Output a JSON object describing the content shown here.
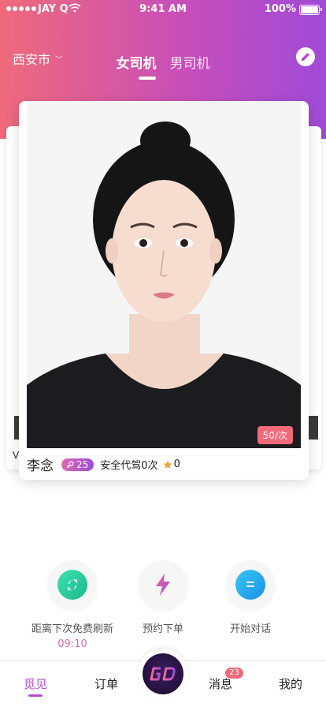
{
  "status_bar": {
    "carrier": "JAY Q",
    "time": "9:41 AM",
    "battery": "100%"
  },
  "header": {
    "city": "西安市",
    "tabs": [
      {
        "label": "女司机"
      },
      {
        "label": "男司机"
      }
    ]
  },
  "side_letter": "V",
  "card": {
    "price": "50/次",
    "name": "李念",
    "age": "25",
    "safe_text": "安全代驾0次",
    "rating": "0"
  },
  "actions": [
    {
      "label": "距离下次免费刷新",
      "sub": "09:10",
      "icon": "refresh-icon"
    },
    {
      "label": "预约下单",
      "icon": "lightning-icon"
    },
    {
      "label": "开始对话",
      "icon": "chat-icon"
    }
  ],
  "bottom_nav": {
    "items": [
      {
        "label": "觅见"
      },
      {
        "label": "订单"
      },
      {
        "label": "消息"
      },
      {
        "label": "我的"
      }
    ],
    "msg_badge": "23",
    "center_icon": "gd-logo-icon"
  },
  "colors": {
    "accent": "#b84ad0",
    "gradient_start": "#f06a7a",
    "gradient_end": "#a04ad8"
  }
}
